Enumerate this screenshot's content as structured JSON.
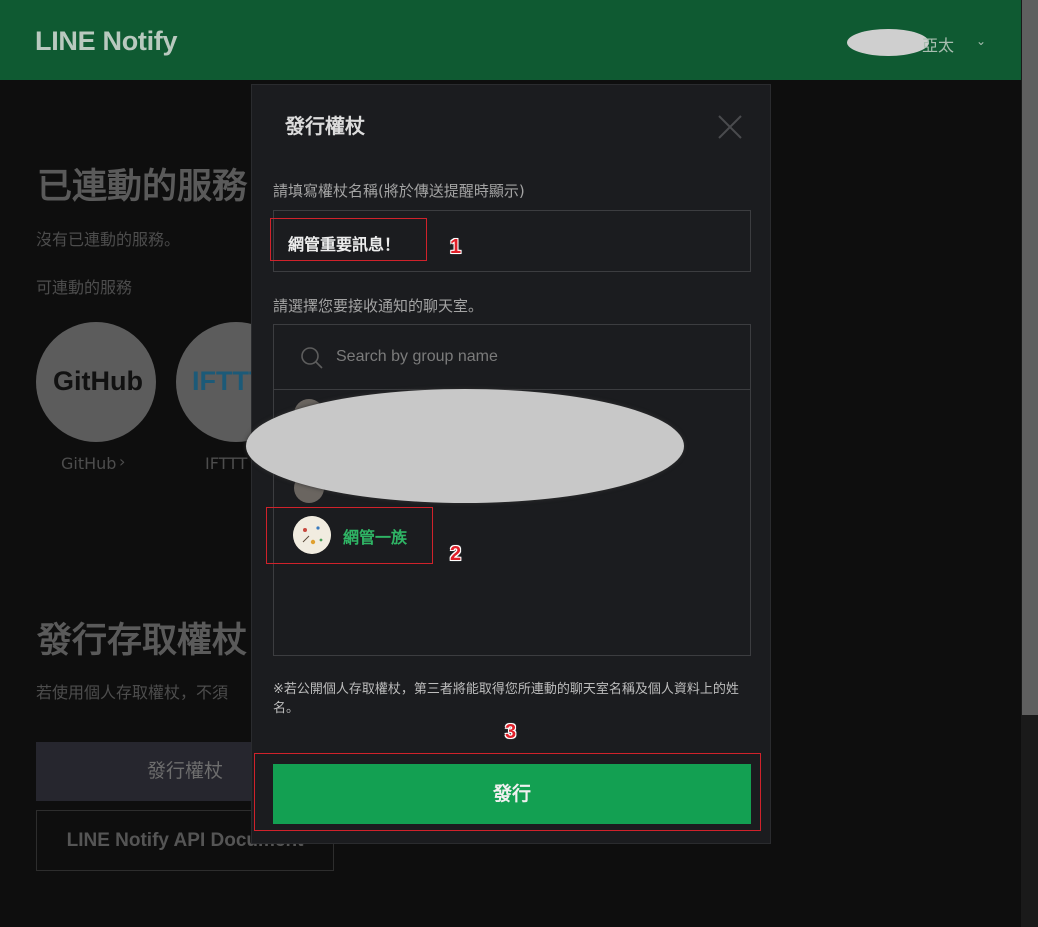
{
  "header": {
    "logo": "LINE Notify",
    "user_name": "亞太",
    "user_chevron": "⌄"
  },
  "background": {
    "linked_services_title": "已連動的服務",
    "no_linked_services": "沒有已連動的服務。",
    "available_services_label": "可連動的服務",
    "services": [
      {
        "logo": "GitHub",
        "label": "GitHub",
        "chevron": "›"
      },
      {
        "logo": "IFTTT",
        "label": "IFTTT"
      }
    ],
    "issue_token_title": "發行存取權杖",
    "issue_token_desc": "若使用個人存取權杖，不須",
    "issue_token_button": "發行權杖",
    "api_doc_button": "LINE Notify API Document"
  },
  "modal": {
    "title": "發行權杖",
    "token_name_label": "請填寫權杖名稱(將於傳送提醒時顯示)",
    "token_name_value": "網管重要訊息！",
    "chat_select_label": "請選擇您要接收通知的聊天室。",
    "search_placeholder": "Search by group name",
    "rooms": [
      {
        "name": "網管一族",
        "selected": true
      }
    ],
    "note": "※若公開個人存取權杖，第三者將能取得您所連動的聊天室名稱及個人資料上的姓名。",
    "issue_button": "發行"
  },
  "annotations": [
    "1",
    "2",
    "3"
  ],
  "colors": {
    "header_bg": "#0f5a32",
    "issue_button": "#13a052",
    "selected_room_text": "#2fb565",
    "annotation_red": "#d0222b"
  }
}
